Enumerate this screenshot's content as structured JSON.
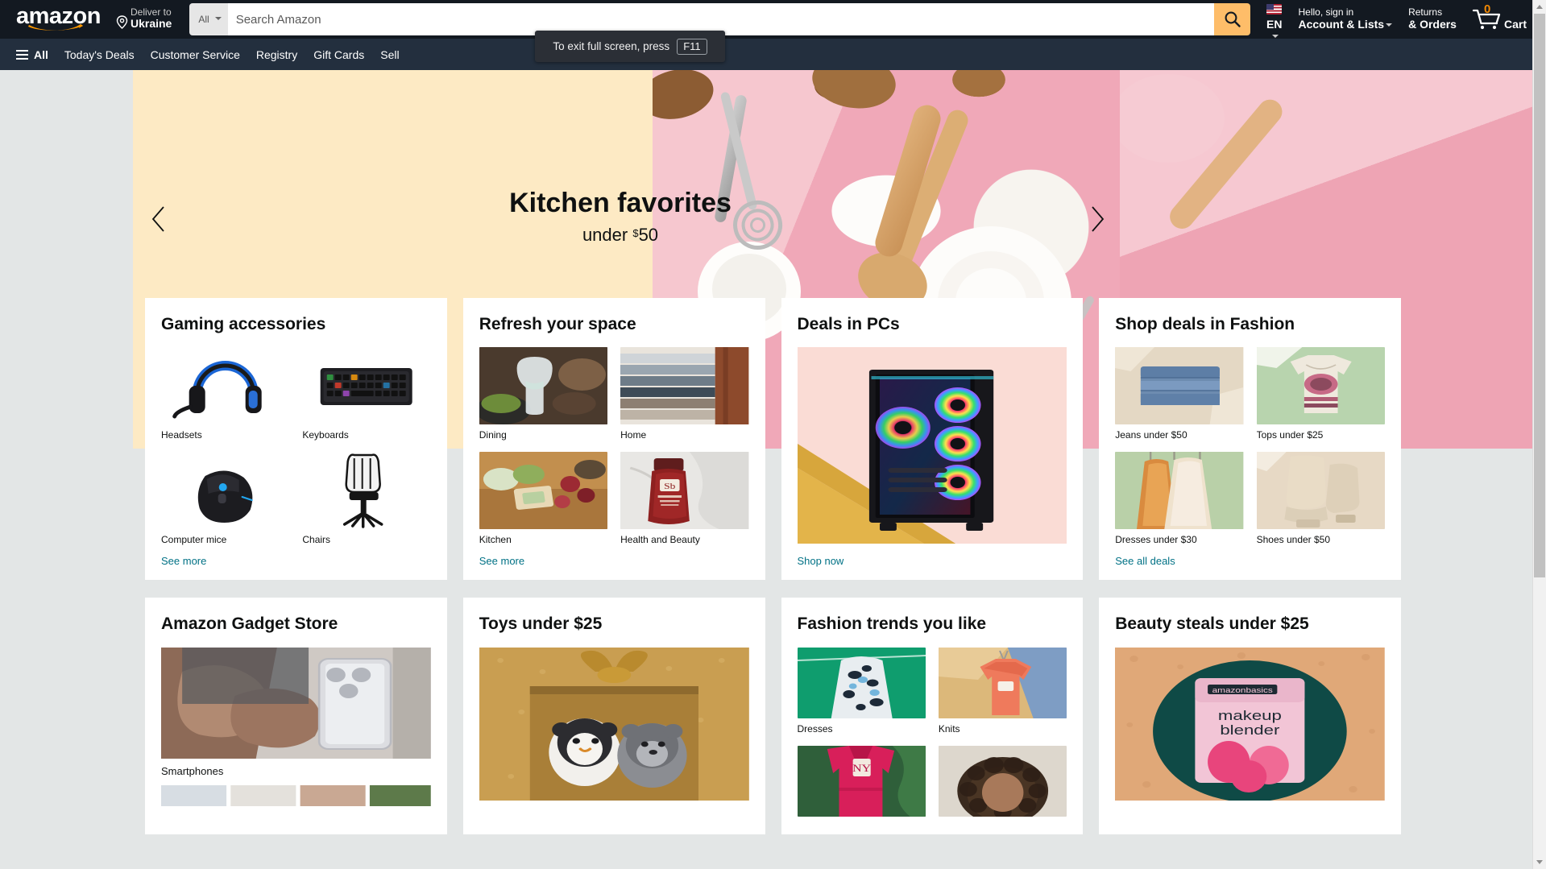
{
  "browser": {
    "fullscreen_tooltip": {
      "text": "To exit full screen, press",
      "key": "F11"
    }
  },
  "header": {
    "logo": "amazon",
    "deliver": {
      "line1": "Deliver to",
      "line2": "Ukraine",
      "icon": "location-pin-icon"
    },
    "search": {
      "category": "All",
      "placeholder": "Search Amazon",
      "value": "",
      "button_icon": "search-icon"
    },
    "language": {
      "code": "EN",
      "flag": "us-flag-icon"
    },
    "account": {
      "line1": "Hello, sign in",
      "line2": "Account & Lists"
    },
    "returns": {
      "line1": "Returns",
      "line2": "& Orders"
    },
    "cart": {
      "count": "0",
      "label": "Cart",
      "icon": "shopping-cart-icon"
    }
  },
  "subnav": {
    "all_label": "All",
    "menu_icon": "hamburger-menu-icon",
    "items": [
      {
        "label": "Today's Deals"
      },
      {
        "label": "Customer Service"
      },
      {
        "label": "Registry"
      },
      {
        "label": "Gift Cards"
      },
      {
        "label": "Sell"
      }
    ]
  },
  "hero": {
    "title": "Kitchen favorites",
    "subtitle_prefix": "under ",
    "subtitle_currency": "$",
    "subtitle_amount": "50",
    "prev_icon": "chevron-left-icon",
    "next_icon": "chevron-right-icon"
  },
  "cards": {
    "row1": [
      {
        "title": "Gaming accessories",
        "type": "quad",
        "tiles": [
          {
            "label": "Headsets",
            "art": "headset"
          },
          {
            "label": "Keyboards",
            "art": "keyboard"
          },
          {
            "label": "Computer mice",
            "art": "mouse"
          },
          {
            "label": "Chairs",
            "art": "chair"
          }
        ],
        "link": "See more"
      },
      {
        "title": "Refresh your space",
        "type": "quad",
        "tiles": [
          {
            "label": "Dining",
            "art": "dining"
          },
          {
            "label": "Home",
            "art": "home"
          },
          {
            "label": "Kitchen",
            "art": "kitchen"
          },
          {
            "label": "Health and Beauty",
            "art": "beauty"
          }
        ],
        "link": "See more"
      },
      {
        "title": "Deals in PCs",
        "type": "single",
        "art": "pc-tower",
        "link": "Shop now"
      },
      {
        "title": "Shop deals in Fashion",
        "type": "quad",
        "tiles": [
          {
            "label": "Jeans under $50",
            "art": "jeans"
          },
          {
            "label": "Tops under $25",
            "art": "tops"
          },
          {
            "label": "Dresses under $30",
            "art": "dresses"
          },
          {
            "label": "Shoes under $50",
            "art": "shoes"
          }
        ],
        "link": "See all deals"
      }
    ],
    "row2": [
      {
        "title": "Amazon Gadget Store",
        "type": "single-label",
        "art": "smartphone",
        "label": "Smartphones"
      },
      {
        "title": "Toys under $25",
        "type": "single",
        "art": "toys"
      },
      {
        "title": "Fashion trends you like",
        "type": "quad",
        "tiles": [
          {
            "label": "Dresses",
            "art": "f-dress"
          },
          {
            "label": "Knits",
            "art": "f-knit"
          },
          {
            "label": "",
            "art": "f-jacket"
          },
          {
            "label": "",
            "art": "f-hair"
          }
        ]
      },
      {
        "title": "Beauty steals under $25",
        "type": "single",
        "art": "makeup"
      }
    ]
  },
  "colors": {
    "nav_bg": "#131921",
    "subnav_bg": "#232f3e",
    "page_bg": "#e3e6e6",
    "accent_orange": "#febd69",
    "link_teal": "#007185",
    "hero_cream": "#fdeac4"
  }
}
